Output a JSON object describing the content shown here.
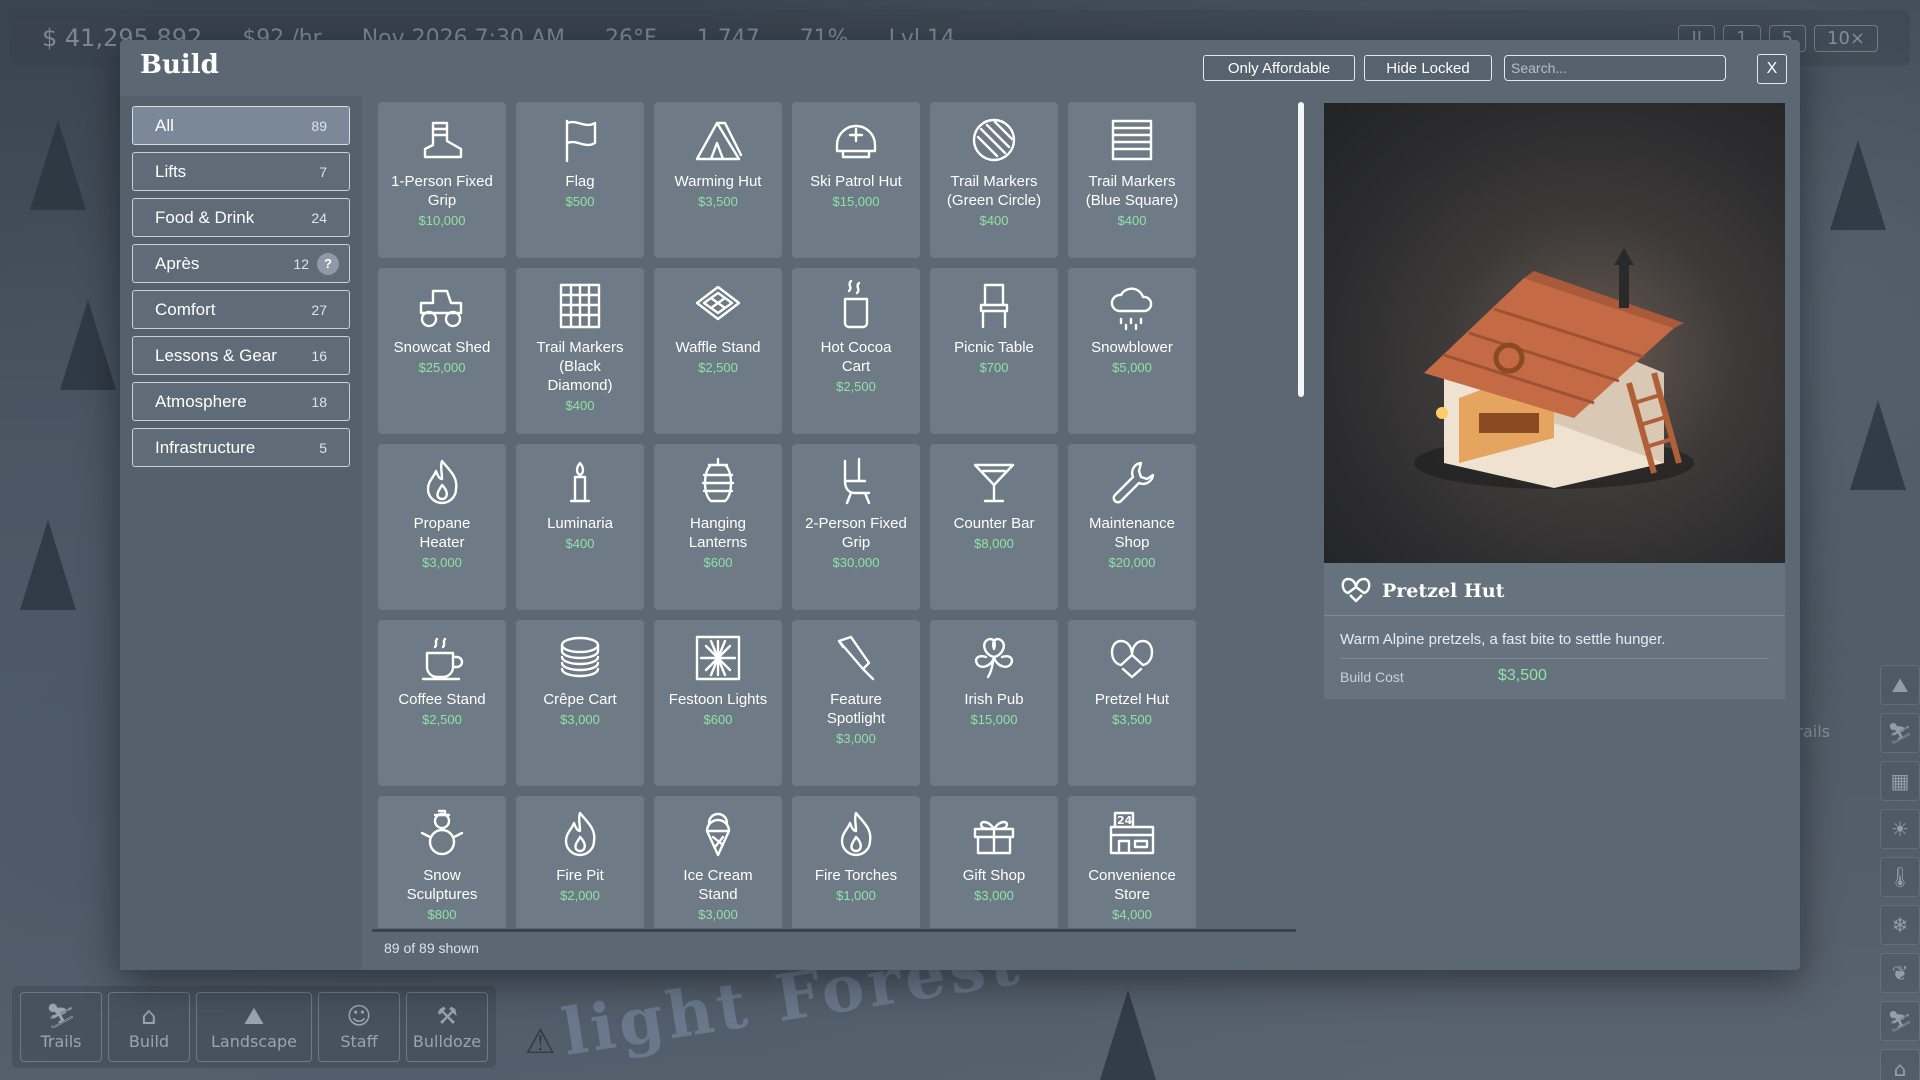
{
  "hud": {
    "money": "$ 41,295,892",
    "rate": "$92 /hr",
    "date": "Nov 2026  7:30 AM",
    "temperature": "26°F",
    "guests": "1,747",
    "satisfaction": "71%",
    "level": "Lvl 14",
    "speeds": [
      "II",
      "1",
      "5",
      "10×"
    ]
  },
  "modal": {
    "title": "Build",
    "only_affordable": "Only Affordable",
    "hide_locked": "Hide Locked",
    "search_placeholder": "Search...",
    "close": "X",
    "shown_count": "89 of 89 shown"
  },
  "categories": [
    {
      "label": "All",
      "count": "89",
      "active": true
    },
    {
      "label": "Lifts",
      "count": "7"
    },
    {
      "label": "Food & Drink",
      "count": "24"
    },
    {
      "label": "Après",
      "count": "12",
      "help": "?"
    },
    {
      "label": "Comfort",
      "count": "27"
    },
    {
      "label": "Lessons & Gear",
      "count": "16"
    },
    {
      "label": "Atmosphere",
      "count": "18"
    },
    {
      "label": "Infrastructure",
      "count": "5"
    }
  ],
  "items": [
    {
      "name": "1-Person Fixed\nGrip",
      "price": "$10,000",
      "icon": "boot-icon"
    },
    {
      "name": "Flag",
      "price": "$500",
      "icon": "flag-icon"
    },
    {
      "name": "Warming Hut",
      "price": "$3,500",
      "icon": "tent-icon"
    },
    {
      "name": "Ski Patrol Hut",
      "price": "$15,000",
      "icon": "helmet-icon"
    },
    {
      "name": "Trail Markers\n(Green Circle)",
      "price": "$400",
      "icon": "circle-marker-icon"
    },
    {
      "name": "Trail Markers\n(Blue Square)",
      "price": "$400",
      "icon": "square-marker-icon"
    },
    {
      "name": "Snowcat Shed",
      "price": "$25,000",
      "icon": "tractor-icon"
    },
    {
      "name": "Trail Markers\n(Black\nDiamond)",
      "price": "$400",
      "icon": "grid-marker-icon"
    },
    {
      "name": "Waffle Stand",
      "price": "$2,500",
      "icon": "waffle-icon"
    },
    {
      "name": "Hot Cocoa\nCart",
      "price": "$2,500",
      "icon": "cocoa-cup-icon"
    },
    {
      "name": "Picnic Table",
      "price": "$700",
      "icon": "chair-icon"
    },
    {
      "name": "Snowblower",
      "price": "$5,000",
      "icon": "snow-cloud-icon"
    },
    {
      "name": "Propane\nHeater",
      "price": "$3,000",
      "icon": "flame-icon"
    },
    {
      "name": "Luminaria",
      "price": "$400",
      "icon": "candle-icon"
    },
    {
      "name": "Hanging\nLanterns",
      "price": "$600",
      "icon": "lantern-icon"
    },
    {
      "name": "2-Person Fixed\nGrip",
      "price": "$30,000",
      "icon": "lift-seat-icon"
    },
    {
      "name": "Counter Bar",
      "price": "$8,000",
      "icon": "cocktail-icon"
    },
    {
      "name": "Maintenance\nShop",
      "price": "$20,000",
      "icon": "wrench-icon"
    },
    {
      "name": "Coffee Stand",
      "price": "$2,500",
      "icon": "coffee-cup-icon"
    },
    {
      "name": "Crêpe Cart",
      "price": "$3,000",
      "icon": "crepe-stack-icon"
    },
    {
      "name": "Festoon Lights",
      "price": "$600",
      "icon": "firework-icon"
    },
    {
      "name": "Feature\nSpotlight",
      "price": "$3,000",
      "icon": "flashlight-icon"
    },
    {
      "name": "Irish Pub",
      "price": "$15,000",
      "icon": "clover-icon"
    },
    {
      "name": "Pretzel Hut",
      "price": "$3,500",
      "icon": "pretzel-icon"
    },
    {
      "name": "Snow\nSculptures",
      "price": "$800",
      "icon": "snowman-icon"
    },
    {
      "name": "Fire Pit",
      "price": "$2,000",
      "icon": "flame-icon"
    },
    {
      "name": "Ice Cream\nStand",
      "price": "$3,000",
      "icon": "ice-cream-icon"
    },
    {
      "name": "Fire Torches",
      "price": "$1,000",
      "icon": "flame-icon"
    },
    {
      "name": "Gift Shop",
      "price": "$3,000",
      "icon": "gift-icon"
    },
    {
      "name": "Convenience\nStore",
      "price": "$4,000",
      "icon": "store-24-icon"
    }
  ],
  "detail": {
    "title": "Pretzel Hut",
    "description": "Warm Alpine pretzels, a fast bite to settle hunger.",
    "cost_label": "Build Cost",
    "cost_value": "$3,500",
    "icon": "pretzel-icon"
  },
  "side_tools": {
    "ski_trails_label": "ski trails"
  },
  "bottom_bar": [
    {
      "label": "Trails",
      "icon": "skier-icon"
    },
    {
      "label": "Build",
      "icon": "build-icon"
    },
    {
      "label": "Landscape",
      "icon": "mountain-icon"
    },
    {
      "label": "Staff",
      "icon": "person-icon"
    },
    {
      "label": "Bulldoze",
      "icon": "bulldoze-icon"
    }
  ],
  "scene": {
    "map_label": "light Forest"
  },
  "colors": {
    "price_green": "#8fe3a6",
    "modal_bg": "#5b6773",
    "card_bg": "#6e7a86"
  }
}
